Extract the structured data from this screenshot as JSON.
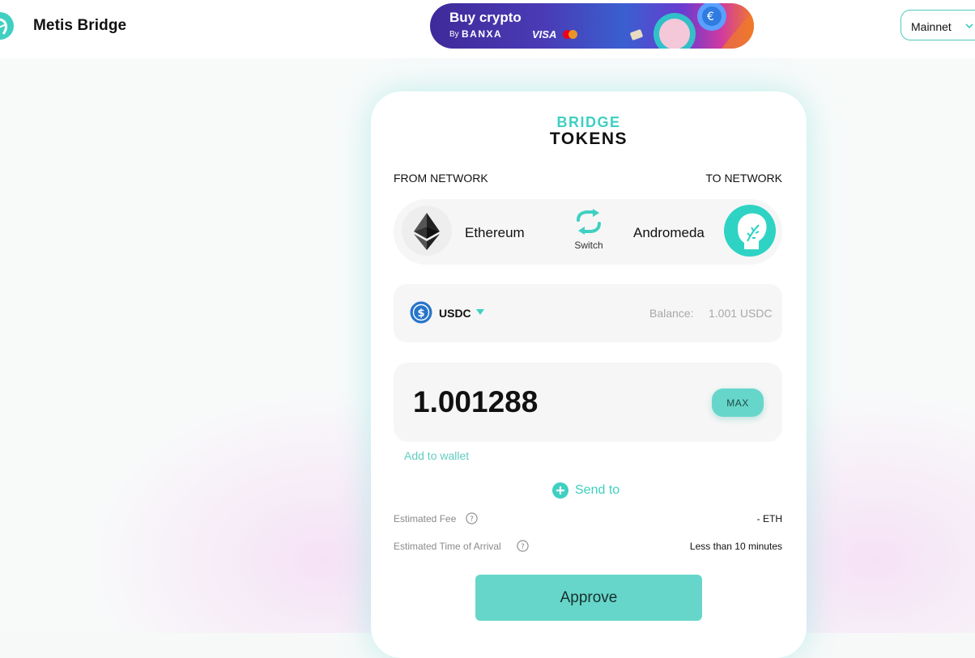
{
  "header": {
    "brand": "Metis Bridge",
    "banner": {
      "title": "Buy crypto",
      "by": "By",
      "partner": "BANXA",
      "visa": "VISA"
    },
    "network_selector": {
      "label": "Mainnet"
    }
  },
  "card": {
    "title_top": "BRIDGE",
    "title_bottom": "TOKENS",
    "from_label": "FROM NETWORK",
    "to_label": "TO NETWORK",
    "from_network": "Ethereum",
    "to_network": "Andromeda",
    "switch_label": "Switch",
    "token": {
      "symbol": "USDC",
      "balance_label": "Balance:",
      "balance_value": "1.001 USDC"
    },
    "amount": {
      "value": "1.001288",
      "max_label": "MAX"
    },
    "add_to_wallet": "Add to wallet",
    "send_to": "Send to",
    "fee": {
      "label": "Estimated Fee",
      "value": "- ETH"
    },
    "eta": {
      "label": "Estimated Time of Arrival",
      "value": "Less than 10 minutes"
    },
    "approve_label": "Approve"
  },
  "colors": {
    "accent": "#3fd0c2",
    "button": "#67d6ca",
    "banner_start": "#3f2a9a",
    "banner_end": "#f07a2a"
  },
  "icons": {
    "logo": "metis-logo-icon",
    "ethereum": "ethereum-icon",
    "metis": "metis-andromeda-icon",
    "switch": "switch-arrows-icon",
    "usdc": "usdc-icon",
    "plus": "plus-circle-icon",
    "help": "question-circle-icon",
    "chevron": "chevron-down-icon"
  }
}
